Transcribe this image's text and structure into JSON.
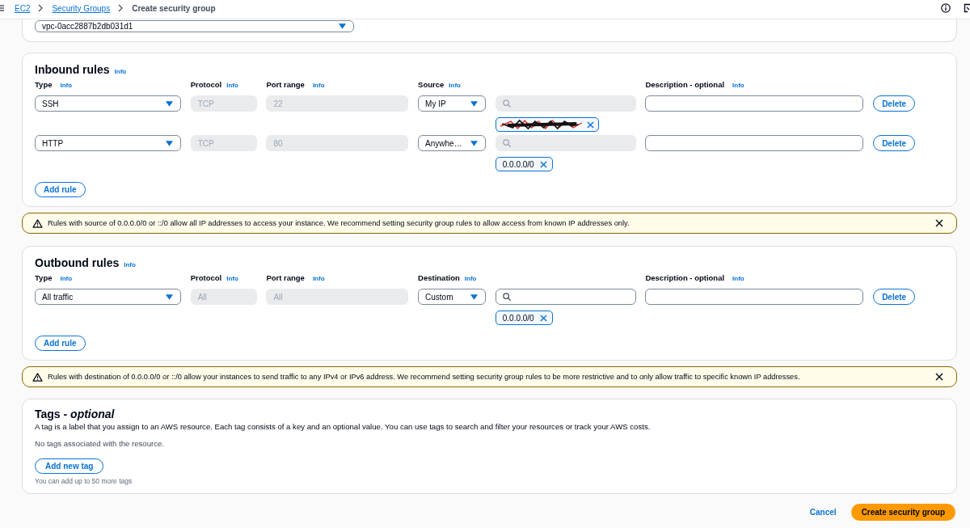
{
  "breadcrumbs": [
    {
      "label": "EC2",
      "link": true
    },
    {
      "label": "Security Groups",
      "link": true
    },
    {
      "label": "Create security group",
      "link": false
    }
  ],
  "vpc_select": {
    "value": "vpc-0acc2887b2db031d1"
  },
  "inbound_rules": {
    "title": "Inbound rules",
    "info": "Info",
    "columns": [
      {
        "label": "Type",
        "info": "Info"
      },
      {
        "label": "Protocol",
        "info": "Info"
      },
      {
        "label": "Port range",
        "info": "Info"
      },
      {
        "label": "Source",
        "info": "Info"
      },
      {
        "label": "Description - optional",
        "info": "Info"
      }
    ],
    "rules": [
      {
        "type": "SSH",
        "protocol": {
          "value": "TCP",
          "disabled": true
        },
        "port_range": {
          "value": "22",
          "disabled": true
        },
        "target": "My IP",
        "search": {
          "disabled": true
        },
        "tokens": [
          {
            "kind": "redacted"
          }
        ],
        "delete": "Delete"
      },
      {
        "type": "HTTP",
        "protocol": {
          "value": "TCP",
          "disabled": true
        },
        "port_range": {
          "value": "80",
          "disabled": true
        },
        "target": "Anywhe…",
        "search": {
          "disabled": true
        },
        "tokens": [
          {
            "kind": "cidr",
            "label": "0.0.0.0/0"
          }
        ],
        "delete": "Delete"
      }
    ],
    "add_button": "Add rule",
    "warning": "Rules with source of 0.0.0.0/0 or ::/0 allow all IP addresses to access your instance. We recommend setting security group rules to allow access from known IP addresses only."
  },
  "outbound_rules": {
    "title": "Outbound rules",
    "info": "Info",
    "columns": [
      {
        "label": "Type",
        "info": "Info"
      },
      {
        "label": "Protocol",
        "info": "Info"
      },
      {
        "label": "Port range",
        "info": "Info"
      },
      {
        "label": "Destination",
        "info": "Info"
      },
      {
        "label": "Description - optional",
        "info": "Info"
      }
    ],
    "rules": [
      {
        "type": "All traffic",
        "protocol": {
          "value": "All",
          "disabled": true
        },
        "port_range": {
          "value": "All",
          "disabled": true
        },
        "target": "Custom",
        "search": {
          "disabled": false
        },
        "tokens": [
          {
            "kind": "cidr",
            "label": "0.0.0.0/0"
          }
        ],
        "delete": "Delete"
      }
    ],
    "add_button": "Add rule",
    "warning": "Rules with destination of 0.0.0.0/0 or ::/0 allow your instances to send traffic to any IPv4 or IPv6 address. We recommend setting security group rules to be more restrictive and to only allow traffic to specific known IP addresses."
  },
  "tags": {
    "title": "Tags - *optional*",
    "description": "A tag is a label that you assign to an AWS resource. Each tag consists of a key and an optional value. You can use tags to search and filter your resources or track your AWS costs.",
    "empty_text": "No tags associated with the resource.",
    "add_button": "Add new tag",
    "hint": "You can add up to 50 more tags"
  },
  "footer": {
    "cancel": "Cancel",
    "submit": "Create security group"
  }
}
